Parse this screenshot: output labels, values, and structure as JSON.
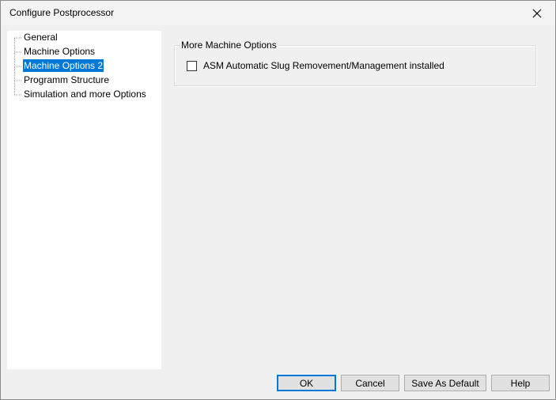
{
  "window": {
    "title": "Configure Postprocessor"
  },
  "tree": {
    "items": [
      {
        "label": "General",
        "selected": false
      },
      {
        "label": "Machine Options",
        "selected": false
      },
      {
        "label": "Machine Options 2",
        "selected": true
      },
      {
        "label": "Programm Structure",
        "selected": false
      },
      {
        "label": "Simulation and more Options",
        "selected": false
      }
    ]
  },
  "panel": {
    "group_caption": "More Machine Options",
    "checkbox_label": "ASM Automatic Slug Removement/Management installed",
    "checkbox_checked": false
  },
  "buttons": {
    "ok": "OK",
    "cancel": "Cancel",
    "save_default": "Save As Default",
    "help": "Help"
  },
  "icons": {
    "close": "close-icon"
  },
  "colors": {
    "selection": "#0078d7",
    "dialog_bg": "#f0f0f0"
  }
}
